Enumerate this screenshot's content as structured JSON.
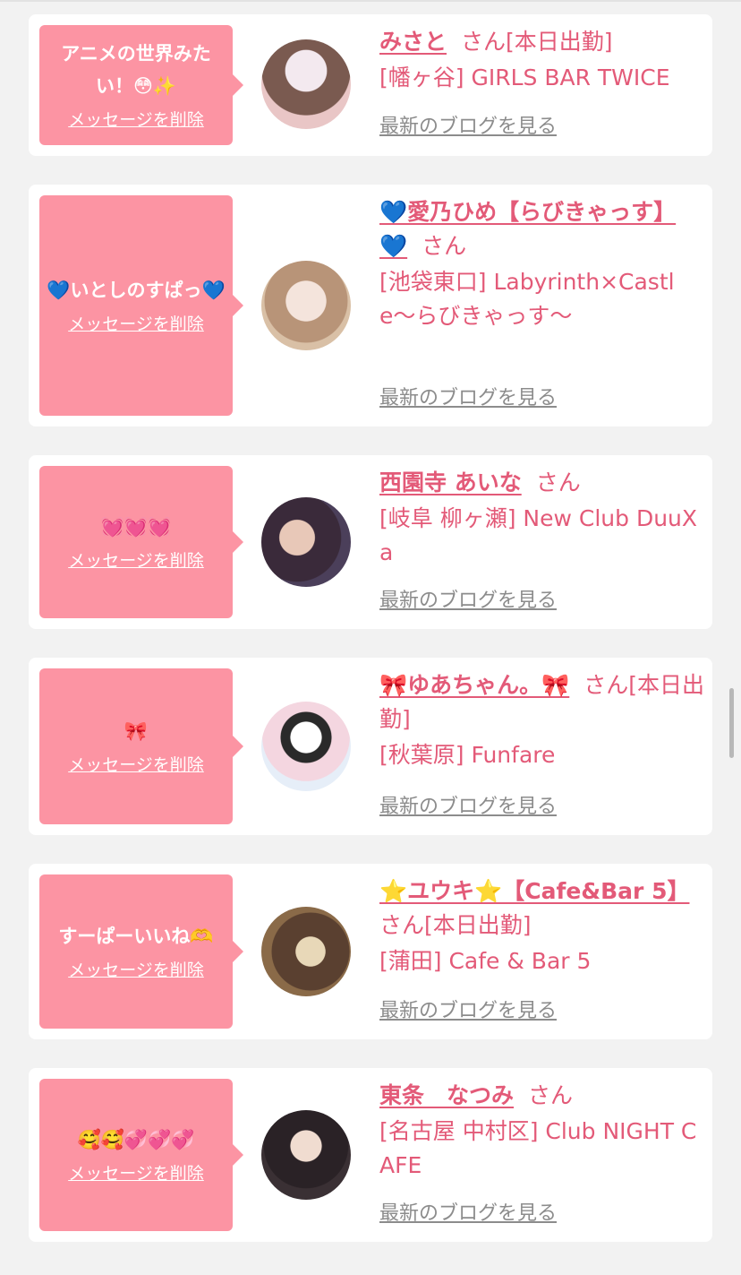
{
  "delete_label": "メッセージを削除",
  "blog_label": "最新のブログを見る",
  "san": "さん",
  "items": [
    {
      "message": "アニメの世界みたい！😳✨",
      "name": "みさと",
      "status": "さん[本日出勤]",
      "shop": "[幡ヶ谷] GIRLS BAR TWICE"
    },
    {
      "message": "💙いとしのすぱっ💙",
      "name": "💙愛乃ひめ【らびきゃっす】💙",
      "status": "さん",
      "shop": "[池袋東口] Labyrinth×Castle〜らびきゃっす〜"
    },
    {
      "message": "💓💓💓",
      "name": "西園寺 あいな",
      "status": "さん",
      "shop": "[岐阜 柳ヶ瀬] New Club DuuXa"
    },
    {
      "message": "🎀",
      "name": "🎀ゆあちゃん。🎀",
      "status": "さん[本日出勤]",
      "shop": "[秋葉原] Funfare"
    },
    {
      "message": "すーぱーいいね🫶",
      "name": "⭐ユウキ⭐【Cafe&Bar 5】",
      "status": "さん[本日出勤]",
      "shop": "[蒲田] Cafe & Bar 5"
    },
    {
      "message": "🥰🥰💞💞💞",
      "name": "東条　なつみ",
      "status": "さん",
      "shop": "[名古屋 中村区] Club NIGHT CAFE"
    }
  ],
  "colors": {
    "accent": "#e35a78",
    "bubble": "#fc94a3",
    "muted": "#8c8c8c",
    "background": "#f2f2f2"
  }
}
